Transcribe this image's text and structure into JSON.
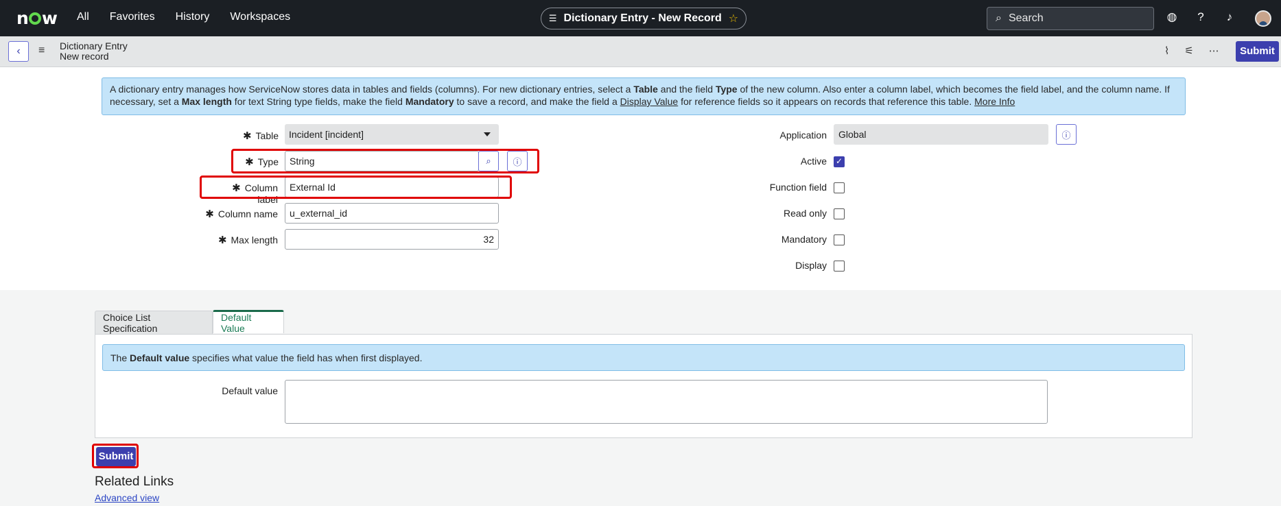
{
  "topnav": {
    "logo": "now",
    "links": [
      "All",
      "Favorites",
      "History",
      "Workspaces"
    ],
    "context_title": "Dictionary Entry - New Record",
    "search_placeholder": "Search",
    "icons": [
      "globe-icon",
      "help-icon",
      "bell-icon"
    ]
  },
  "header": {
    "title": "Dictionary Entry",
    "subtitle": "New record",
    "submit_label": "Submit",
    "icons": [
      "attachment-icon",
      "settings-sliders-icon",
      "more-icon"
    ]
  },
  "info": {
    "p1": "A dictionary entry manages how ServiceNow stores data in tables and fields (columns). For new dictionary entries, select a ",
    "b1": "Table",
    "p2": " and the field ",
    "b2": "Type",
    "p3": " of the new column. Also enter a column label, which becomes the field label, and the column name. If necessary, set a ",
    "b3": "Max length",
    "p4": " for text String type fields, make the field ",
    "b4": "Mandatory",
    "p5": " to save a record, and make the field a ",
    "u1": "Display Value",
    "p6": " for reference fields so it appears on records that reference this table. ",
    "link": "More Info"
  },
  "form": {
    "table": {
      "label": "Table",
      "value": "Incident [incident]"
    },
    "type": {
      "label": "Type",
      "value": "String"
    },
    "column_label": {
      "label": "Column label",
      "value": "External Id"
    },
    "column_name": {
      "label": "Column name",
      "value": "u_external_id"
    },
    "max_length": {
      "label": "Max length",
      "value": "32"
    },
    "application": {
      "label": "Application",
      "value": "Global"
    },
    "active": {
      "label": "Active",
      "checked": true
    },
    "function_field": {
      "label": "Function field",
      "checked": false
    },
    "read_only": {
      "label": "Read only",
      "checked": false
    },
    "mandatory": {
      "label": "Mandatory",
      "checked": false
    },
    "display": {
      "label": "Display",
      "checked": false
    }
  },
  "tabs": [
    {
      "label": "Choice List Specification",
      "active": false
    },
    {
      "label": "Default Value",
      "active": true
    }
  ],
  "default_value": {
    "info_pre": "The ",
    "info_bold": "Default value",
    "info_post": " specifies what value the field has when first displayed.",
    "label": "Default value",
    "value": ""
  },
  "footer": {
    "submit_label": "Submit",
    "related_links_title": "Related Links",
    "advanced_view": "Advanced view"
  },
  "colors": {
    "accent": "#3c3fae",
    "highlight": "#e00000",
    "info_bg": "#c4e4f9"
  }
}
